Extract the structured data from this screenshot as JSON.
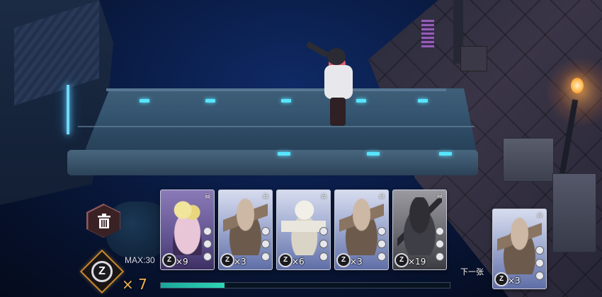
{
  "hud": {
    "max_label": "MAX:30",
    "z_currency_symbol": "Z",
    "z_count": "× 7",
    "energy_fraction": 0.22
  },
  "hand": [
    {
      "id": "card-1",
      "variant": "purple",
      "art": "girl",
      "count": "×9",
      "coin": "Z"
    },
    {
      "id": "card-2",
      "variant": "blue",
      "art": "creature",
      "count": "×3",
      "coin": "Z"
    },
    {
      "id": "card-3",
      "variant": "blue",
      "art": "astronaut",
      "count": "×6",
      "coin": "Z"
    },
    {
      "id": "card-4",
      "variant": "blue",
      "art": "creature",
      "count": "×3",
      "coin": "Z"
    },
    {
      "id": "card-5",
      "variant": "grey",
      "art": "mech",
      "count": "×19",
      "coin": "Z"
    }
  ],
  "next": {
    "label": "下一张",
    "card": {
      "variant": "blue",
      "art": "creature",
      "count": "×3",
      "coin": "Z"
    }
  },
  "icons": {
    "trash": "trash-icon",
    "skull": "skull-icon"
  },
  "colors": {
    "accent_gold": "#c8892f",
    "energy": "#2fd6b6"
  }
}
